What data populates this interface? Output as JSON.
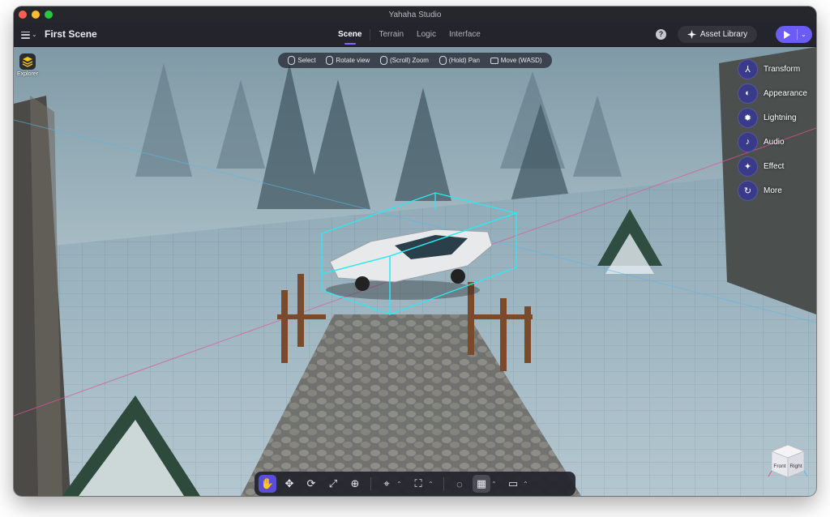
{
  "window": {
    "title": "Yahaha Studio"
  },
  "menubar": {
    "scene_name": "First Scene",
    "tabs": [
      {
        "label": "Scene",
        "active": true
      },
      {
        "label": "Terrain",
        "active": false
      },
      {
        "label": "Logic",
        "active": false
      },
      {
        "label": "Interface",
        "active": false
      }
    ],
    "help_label": "?",
    "asset_library_label": "Asset Library"
  },
  "explorer": {
    "label": "Explorer",
    "icon": "layers-icon"
  },
  "hints": [
    {
      "label": "Select",
      "icon": "mouse-left-icon"
    },
    {
      "label": "Rotate view",
      "icon": "mouse-right-icon"
    },
    {
      "label": "(Scroll) Zoom",
      "icon": "mouse-scroll-icon"
    },
    {
      "label": "(Hold) Pan",
      "icon": "mouse-middle-icon"
    },
    {
      "label": "Move (WASD)",
      "icon": "keyboard-icon"
    }
  ],
  "properties": [
    {
      "label": "Transform",
      "icon": "transform-icon"
    },
    {
      "label": "Appearance",
      "icon": "appearance-icon"
    },
    {
      "label": "Lightning",
      "icon": "light-bulb-icon"
    },
    {
      "label": "Audio",
      "icon": "speaker-icon"
    },
    {
      "label": "Effect",
      "icon": "magic-wand-icon"
    },
    {
      "label": "More",
      "icon": "more-icon"
    }
  ],
  "view_cube": {
    "front": "Front",
    "right": "Right"
  },
  "colors": {
    "accent": "#6b5cf6",
    "selection_box": "#2ee8f0",
    "titlebar": "#26272d"
  }
}
